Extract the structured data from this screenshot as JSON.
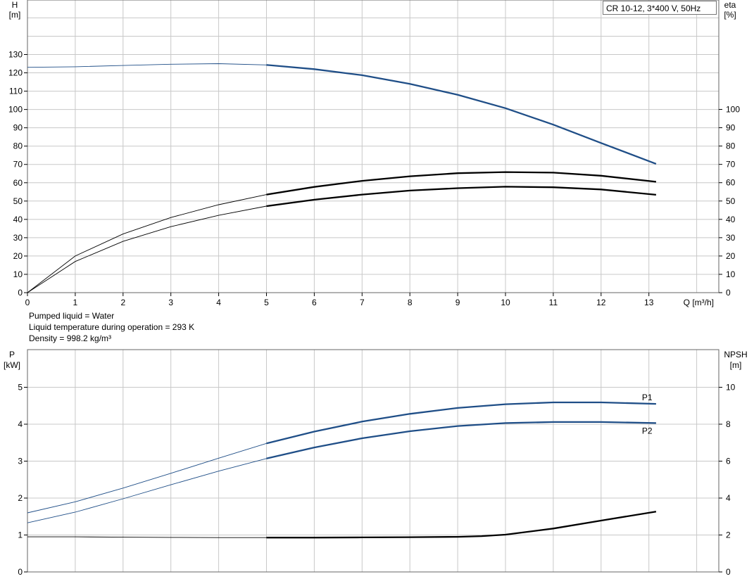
{
  "colors": {
    "blue": "#1f4e87",
    "black": "#000000",
    "grid": "#c8c8c8"
  },
  "legend_label": "CR 10-12, 3*400 V, 50Hz",
  "notes": {
    "liquid": "Pumped liquid = Water",
    "temperature": "Liquid temperature during operation = 293 K",
    "density": "Density = 998.2 kg/m³"
  },
  "chart_data": [
    {
      "type": "line",
      "title": "",
      "left_axis": {
        "label_top": "H",
        "label_unit": "[m]",
        "range": [
          0,
          130
        ],
        "ticks": [
          0,
          10,
          20,
          30,
          40,
          50,
          60,
          70,
          80,
          90,
          100,
          110,
          120,
          130
        ]
      },
      "right_axis": {
        "label_top": "eta",
        "label_unit": "[%]",
        "range": [
          0,
          100
        ],
        "ticks": [
          0,
          10,
          20,
          30,
          40,
          50,
          60,
          70,
          80,
          90,
          100
        ]
      },
      "x_axis": {
        "label": "Q [m³/h]",
        "range": [
          0,
          14.5
        ],
        "ticks": [
          0,
          1,
          2,
          3,
          4,
          5,
          6,
          7,
          8,
          9,
          10,
          11,
          12,
          13
        ]
      },
      "grid": true,
      "series": [
        {
          "key": "H",
          "axis": "left",
          "color": "blue",
          "x": [
            0,
            1,
            2,
            3,
            4,
            5,
            6,
            7,
            8,
            9,
            10,
            11,
            12,
            13.15
          ],
          "y": [
            123,
            123.3,
            124,
            124.7,
            125,
            124.3,
            122,
            118.7,
            114,
            108,
            100.7,
            91.7,
            81.7,
            70.3
          ]
        },
        {
          "key": "eta_upper",
          "axis": "right",
          "color": "black",
          "x": [
            0,
            1,
            2,
            3,
            4,
            5,
            6,
            7,
            8,
            9,
            10,
            11,
            12,
            13.15
          ],
          "y": [
            0,
            20,
            32,
            41,
            48,
            53.5,
            57.7,
            61,
            63.5,
            65.2,
            65.8,
            65.5,
            63.8,
            60.5
          ]
        },
        {
          "key": "eta_lower",
          "axis": "right",
          "color": "black",
          "x": [
            0,
            1,
            2,
            3,
            4,
            5,
            6,
            7,
            8,
            9,
            10,
            11,
            12,
            13.15
          ],
          "y": [
            0,
            17,
            28,
            36,
            42.2,
            47.2,
            50.7,
            53.5,
            55.7,
            57,
            57.8,
            57.5,
            56.3,
            53.4
          ]
        }
      ]
    },
    {
      "type": "line",
      "title": "",
      "left_axis": {
        "label_top": "P",
        "label_unit": "[kW]",
        "range": [
          0,
          5.5
        ],
        "ticks": [
          0,
          1,
          2,
          3,
          4,
          5
        ]
      },
      "right_axis": {
        "label_top": "NPSH",
        "label_unit": "[m]",
        "range": [
          0,
          11
        ],
        "ticks": [
          0,
          2,
          4,
          6,
          8,
          10
        ]
      },
      "x_axis": {
        "label": "",
        "range": [
          0,
          14.5
        ],
        "ticks": []
      },
      "grid": true,
      "series": [
        {
          "key": "P1",
          "name": "P1",
          "axis": "left",
          "color": "blue",
          "x": [
            0,
            1,
            2,
            3,
            4,
            5,
            6,
            7,
            8,
            9,
            10,
            11,
            12,
            13.15
          ],
          "y": [
            1.6,
            1.9,
            2.27,
            2.67,
            3.08,
            3.48,
            3.8,
            4.07,
            4.28,
            4.44,
            4.54,
            4.59,
            4.59,
            4.55
          ]
        },
        {
          "key": "P2",
          "name": "P2",
          "axis": "left",
          "color": "blue",
          "x": [
            0,
            1,
            2,
            3,
            4,
            5,
            6,
            7,
            8,
            9,
            10,
            11,
            12,
            13.15
          ],
          "y": [
            1.33,
            1.62,
            1.98,
            2.36,
            2.73,
            3.07,
            3.37,
            3.62,
            3.81,
            3.95,
            4.03,
            4.06,
            4.06,
            4.03
          ]
        },
        {
          "key": "NPSH",
          "axis": "right",
          "color": "black",
          "x": [
            0,
            1,
            2,
            3,
            4,
            5,
            6,
            7,
            8,
            9,
            9.5,
            10,
            11,
            12,
            13.15
          ],
          "y": [
            1.9,
            1.9,
            1.88,
            1.87,
            1.86,
            1.86,
            1.86,
            1.87,
            1.88,
            1.9,
            1.94,
            2.02,
            2.35,
            2.78,
            3.27
          ]
        }
      ]
    }
  ]
}
